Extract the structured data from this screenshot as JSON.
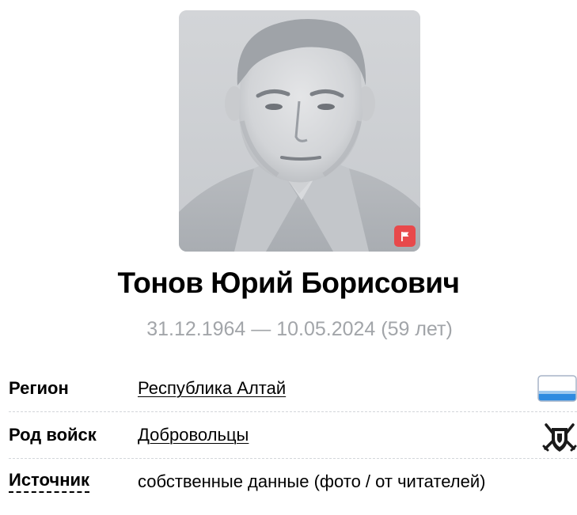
{
  "person": {
    "name": "Тонов Юрий Борисович",
    "dates": "31.12.1964 — 10.05.2024 (59 лет)"
  },
  "photo": {
    "alt_icon": "portrait-photo",
    "badge_icon": "flag-icon",
    "badge_color": "#e8494b"
  },
  "info": {
    "region": {
      "label": "Регион",
      "value": "Республика Алтай",
      "icon": "altai-flag-icon"
    },
    "troops": {
      "label": "Род войск",
      "value": "Добровольцы",
      "icon": "volunteers-emblem-icon"
    },
    "source": {
      "label": "Источник",
      "value": "собственные данные (фото / от читателей)"
    }
  }
}
